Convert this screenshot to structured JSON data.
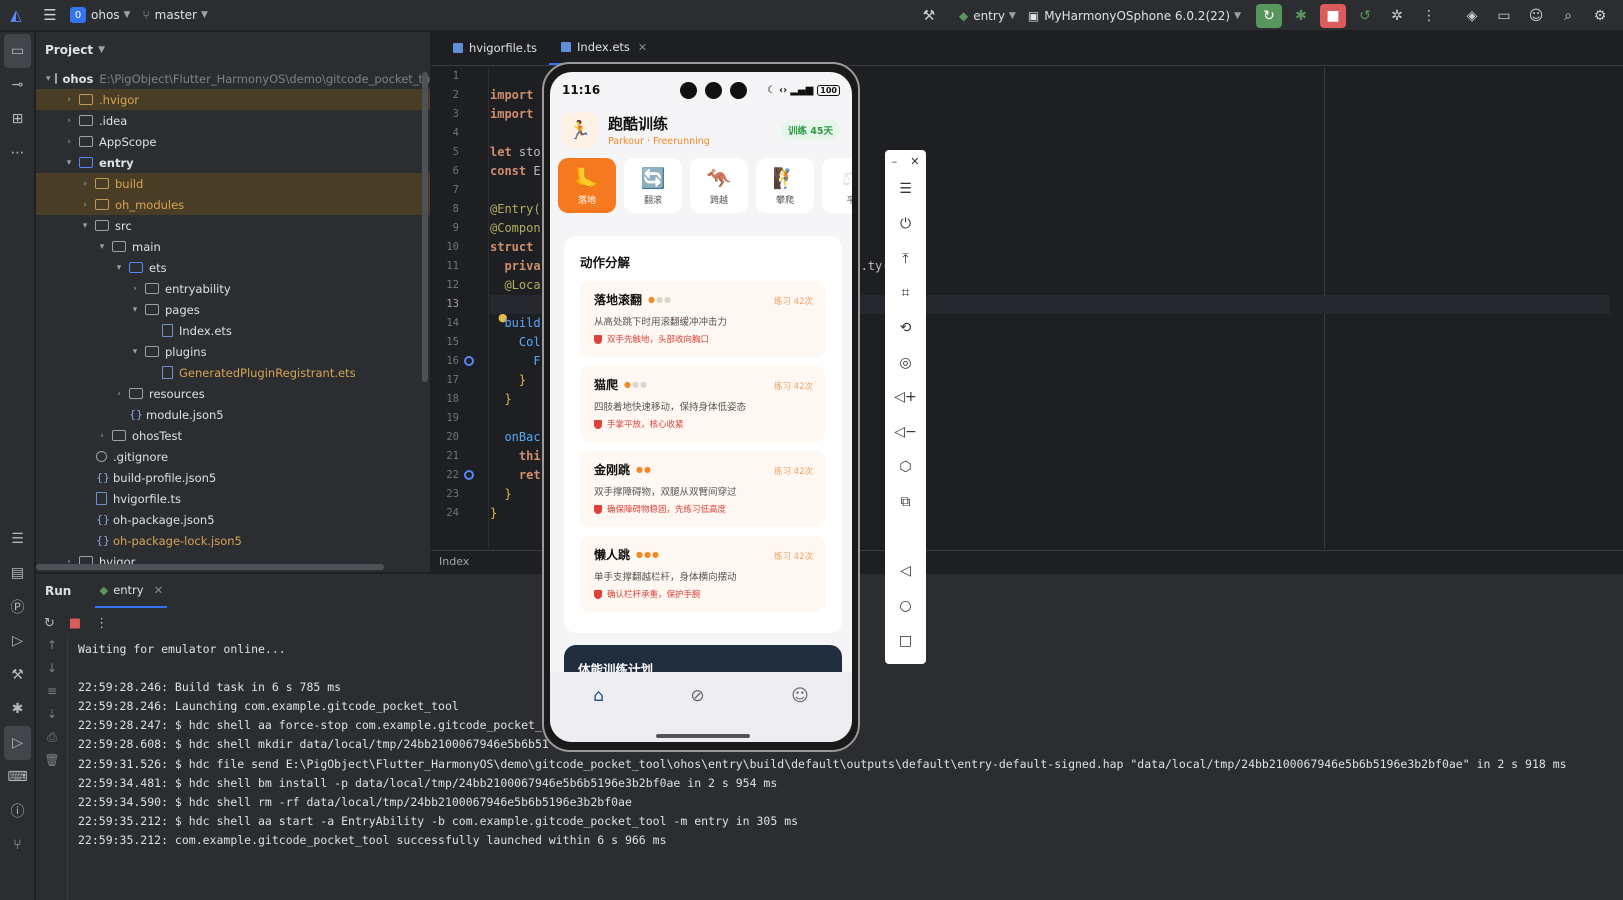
{
  "topbar": {
    "project_badge": "0",
    "project_name": "ohos",
    "branch": "master",
    "run_config": "entry",
    "device": "MyHarmonyOSphone 6.0.2(22)"
  },
  "project": {
    "title": "Project",
    "root_name": "ohos",
    "root_path": "E:\\PigObject\\Flutter_HarmonyOS\\demo\\gitcode_pocket_tool\\oh",
    "items": [
      {
        "label": ".hvigor"
      },
      {
        "label": ".idea"
      },
      {
        "label": "AppScope"
      },
      {
        "label": "entry"
      },
      {
        "label": "build"
      },
      {
        "label": "oh_modules"
      },
      {
        "label": "src"
      },
      {
        "label": "main"
      },
      {
        "label": "ets"
      },
      {
        "label": "entryability"
      },
      {
        "label": "pages"
      },
      {
        "label": "Index.ets"
      },
      {
        "label": "plugins"
      },
      {
        "label": "GeneratedPluginRegistrant.ets"
      },
      {
        "label": "resources"
      },
      {
        "label": "module.json5"
      },
      {
        "label": "ohosTest"
      },
      {
        "label": ".gitignore"
      },
      {
        "label": "build-profile.json5"
      },
      {
        "label": "hvigorfile.ts"
      },
      {
        "label": "oh-package.json5"
      },
      {
        "label": "oh-package-lock.json5"
      },
      {
        "label": "hvigor"
      }
    ]
  },
  "editor": {
    "tabs": [
      {
        "label": "hvigorfile.ts"
      },
      {
        "label": "Index.ets"
      }
    ],
    "line_numbers": [
      "1",
      "2",
      "3",
      "4",
      "5",
      "6",
      "7",
      "8",
      "9",
      "10",
      "11",
      "12",
      "13",
      "14",
      "15",
      "16",
      "17",
      "18",
      "19",
      "20",
      "21",
      "22",
      "23",
      "24"
    ],
    "code": {
      "l2": "import",
      "l3": "import",
      "l5_kw": "let",
      "l5": " sto",
      "l6_kw": "const",
      "l6": " E",
      "l8": "@Entry(",
      "l9": "@Compon",
      "l10_kw": "struct",
      "l11": "  priva",
      "l11_tail": ".ty(",
      "l12": "  @Loca",
      "l14": "  build",
      "l15": "    Col",
      "l16": "      F",
      "l17": "    }",
      "l18": "  }",
      "l20": "  onBac",
      "l21": "    thi",
      "l22": "    ret",
      "l23": "  }",
      "l24": "}"
    },
    "footer": "Index"
  },
  "run": {
    "title": "Run",
    "tab": "entry",
    "console": [
      "Waiting for emulator online...",
      "",
      "22:59:28.246: Build task in 6 s 785 ms",
      "22:59:28.246: Launching com.example.gitcode_pocket_tool",
      "22:59:28.247: $ hdc shell aa force-stop com.example.gitcode_pocket_",
      "22:59:28.608: $ hdc shell mkdir data/local/tmp/24bb2100067946e5b6b51",
      "22:59:31.526: $ hdc file send E:\\PigObject\\Flutter_HarmonyOS\\demo\\gitcode_pocket_tool\\ohos\\entry\\build\\default\\outputs\\default\\entry-default-signed.hap \"data/local/tmp/24bb2100067946e5b6b5196e3b2bf0ae\" in 2 s 918 ms",
      "22:59:34.481: $ hdc shell bm install -p data/local/tmp/24bb2100067946e5b6b5196e3b2bf0ae in 2 s 954 ms",
      "22:59:34.590: $ hdc shell rm -rf data/local/tmp/24bb2100067946e5b6b5196e3b2bf0ae",
      "22:59:35.212: $ hdc shell aa start -a EntryAbility -b com.example.gitcode_pocket_tool -m entry in 305 ms",
      "22:59:35.212: com.example.gitcode_pocket_tool successfully launched within 6 s 966 ms"
    ]
  },
  "phone": {
    "time": "11:16",
    "battery": "100",
    "app_title": "跑酷训练",
    "app_subtitle": "Parkour · Freerunning",
    "badge": "训练 45天",
    "categories": [
      {
        "label": "落地",
        "icon": "foot"
      },
      {
        "label": "翻滚",
        "icon": "roll"
      },
      {
        "label": "跨越",
        "icon": "kangaroo"
      },
      {
        "label": "攀爬",
        "icon": "climb"
      },
      {
        "label": "平",
        "icon": "balance"
      }
    ],
    "section_title": "动作分解",
    "moves": [
      {
        "name": "落地滚翻",
        "level": 1,
        "count": "练习 42次",
        "desc": "从高处跳下时用滚翻缓冲冲击力",
        "tip": "双手先触地，头部收向胸口"
      },
      {
        "name": "猫爬",
        "level": 1,
        "count": "练习 42次",
        "desc": "四肢着地快速移动，保持身体低姿态",
        "tip": "手掌平放，核心收紧"
      },
      {
        "name": "金刚跳",
        "level": 2,
        "count": "练习 42次",
        "desc": "双手撑障碍物，双腿从双臂间穿过",
        "tip": "确保障碍物稳固，先练习低高度"
      },
      {
        "name": "懒人跳",
        "level": 3,
        "count": "练习 42次",
        "desc": "单手支撑翻越栏杆，身体横向摆动",
        "tip": "确认栏杆承重，保护手腕"
      }
    ],
    "plan_title": "体能训练计划"
  }
}
